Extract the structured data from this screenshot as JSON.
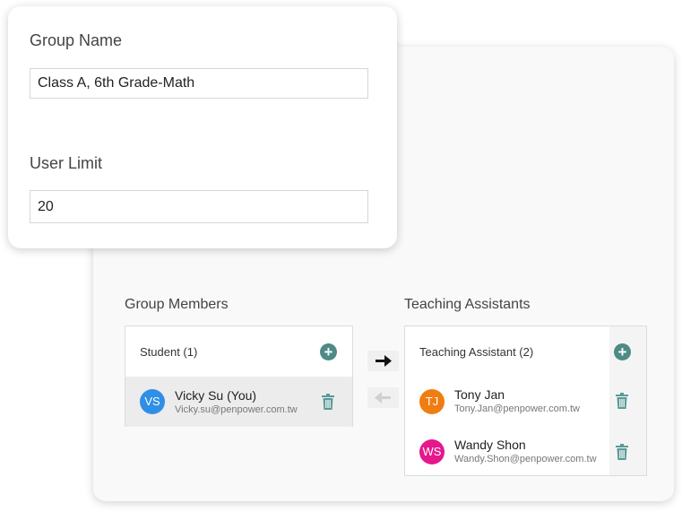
{
  "group_name": {
    "label": "Group Name",
    "value": "Class A, 6th Grade-Math"
  },
  "user_limit": {
    "label": "User Limit",
    "value": "20"
  },
  "members": {
    "title": "Group Members",
    "list_title": "Student (1)",
    "items": [
      {
        "initials": "VS",
        "name": "Vicky Su (You)",
        "email": "Vicky.su@penpower.com.tw",
        "color": "#2f8fe6"
      }
    ]
  },
  "assistants": {
    "title": "Teaching Assistants",
    "list_title": "Teaching Assistant (2)",
    "items": [
      {
        "initials": "TJ",
        "name": "Tony Jan",
        "email": "Tony.Jan@penpower.com.tw",
        "color": "#f07d12"
      },
      {
        "initials": "WS",
        "name": "Wandy Shon",
        "email": "Wandy.Shon@penpower.com.tw",
        "color": "#e6178c"
      }
    ]
  },
  "icons": {
    "add": "plus-circle-icon",
    "delete": "trash-icon",
    "move_right": "arrow-right-icon",
    "move_left": "arrow-left-icon"
  },
  "colors": {
    "accent": "#4e8a86",
    "trash": "#5a9a96",
    "selected_row": "#ececec"
  }
}
